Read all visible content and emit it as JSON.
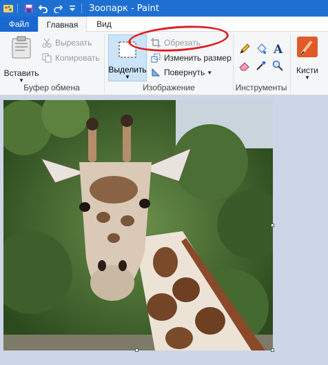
{
  "window": {
    "title": "Зоопарк - Paint"
  },
  "tabs": {
    "file": "Файл",
    "home": "Главная",
    "view": "Вид"
  },
  "clipboard": {
    "paste": "Вставить",
    "cut": "Вырезать",
    "copy": "Копировать",
    "group": "Буфер обмена"
  },
  "image": {
    "select": "Выделить",
    "crop": "Обрезать",
    "resize": "Изменить размер",
    "rotate": "Повернуть",
    "group": "Изображение"
  },
  "tools": {
    "group": "Инструменты"
  },
  "brushes": {
    "label": "Кисти"
  },
  "colors": {
    "accent": "#1f6fd3",
    "annotation": "#e01b24"
  }
}
